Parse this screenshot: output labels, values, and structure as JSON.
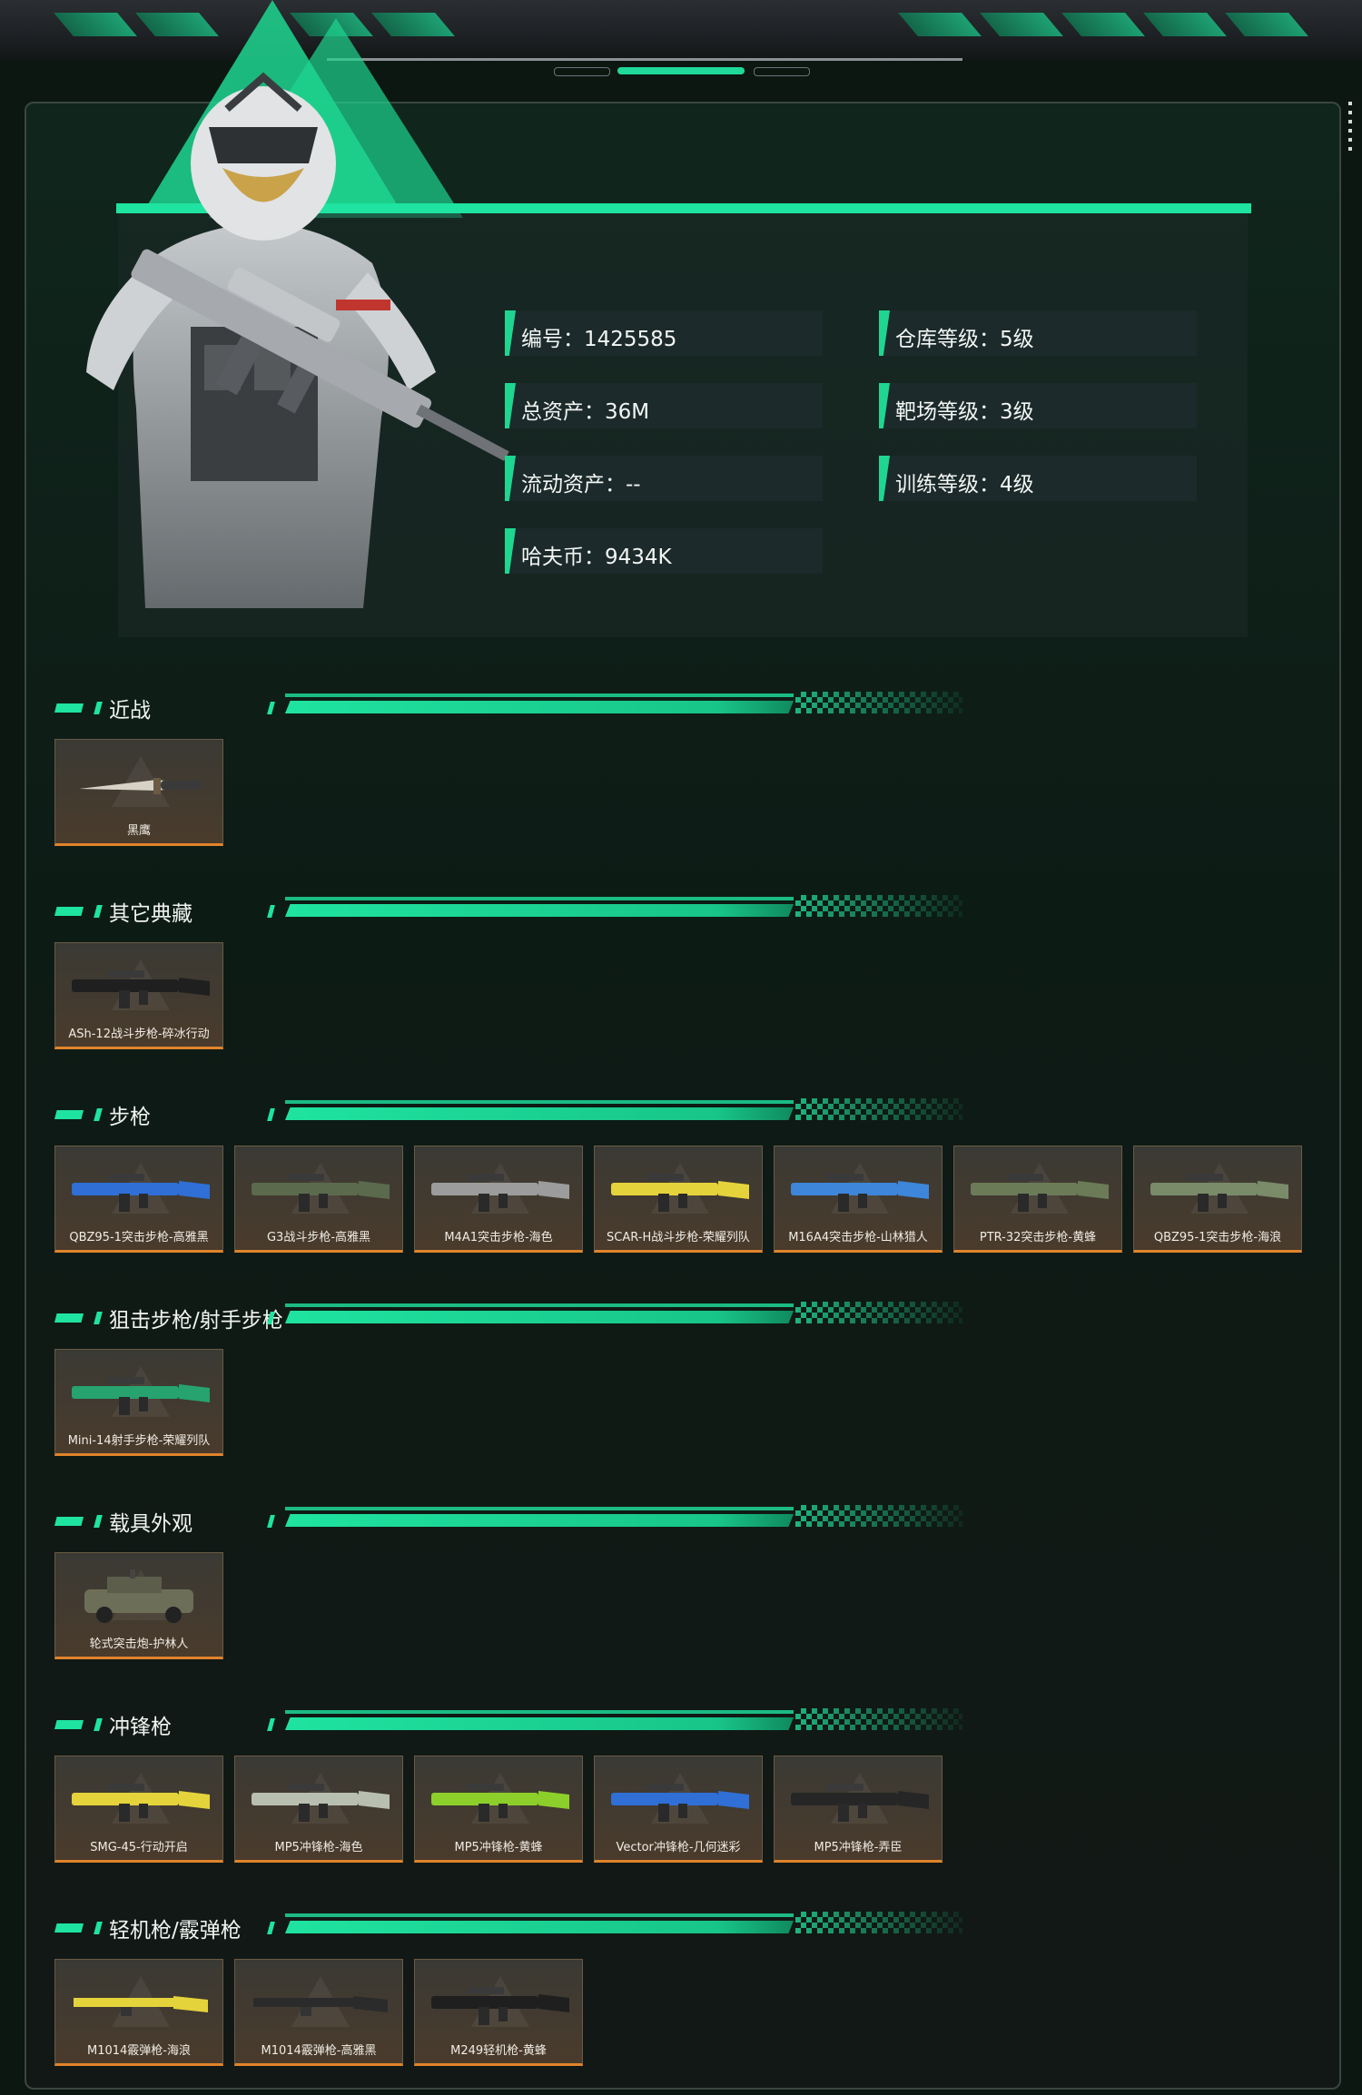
{
  "colors": {
    "accent": "#1fe3a0",
    "card_underline": "#e0842b",
    "background": "#0d1b15"
  },
  "profile": {
    "stats": [
      {
        "label": "编号：1425585"
      },
      {
        "label": "仓库等级：5级"
      },
      {
        "label": "总资产：36M"
      },
      {
        "label": "靶场等级：3级"
      },
      {
        "label": "流动资产：--"
      },
      {
        "label": "训练等级：4级"
      },
      {
        "label": "哈夫币：9434K"
      }
    ]
  },
  "sections": [
    {
      "title": "近战",
      "items": [
        {
          "name": "黑鹰",
          "icon": "knife-icon"
        }
      ]
    },
    {
      "title": "其它典藏",
      "items": [
        {
          "name": "ASh-12战斗步枪-碎冰行动",
          "icon": "rifle-icon"
        }
      ]
    },
    {
      "title": "步枪",
      "items": [
        {
          "name": "QBZ95-1突击步枪-高雅黑",
          "icon": "rifle-icon"
        },
        {
          "name": "G3战斗步枪-高雅黑",
          "icon": "rifle-icon"
        },
        {
          "name": "M4A1突击步枪-海色",
          "icon": "rifle-icon"
        },
        {
          "name": "SCAR-H战斗步枪-荣耀列队",
          "icon": "rifle-icon"
        },
        {
          "name": "M16A4突击步枪-山林猎人",
          "icon": "rifle-icon"
        },
        {
          "name": "PTR-32突击步枪-黄蜂",
          "icon": "rifle-icon"
        },
        {
          "name": "QBZ95-1突击步枪-海浪",
          "icon": "rifle-icon"
        }
      ]
    },
    {
      "title": "狙击步枪/射手步枪",
      "items": [
        {
          "name": "Mini-14射手步枪-荣耀列队",
          "icon": "sniper-icon"
        }
      ]
    },
    {
      "title": "载具外观",
      "items": [
        {
          "name": "轮式突击炮-护林人",
          "icon": "vehicle-icon"
        }
      ]
    },
    {
      "title": "冲锋枪",
      "items": [
        {
          "name": "SMG-45-行动开启",
          "icon": "smg-icon"
        },
        {
          "name": "MP5冲锋枪-海色",
          "icon": "smg-icon"
        },
        {
          "name": "MP5冲锋枪-黄蜂",
          "icon": "smg-icon"
        },
        {
          "name": "Vector冲锋枪-几何迷彩",
          "icon": "smg-icon"
        },
        {
          "name": "MP5冲锋枪-弄臣",
          "icon": "smg-icon"
        }
      ]
    },
    {
      "title": "轻机枪/霰弹枪",
      "items": [
        {
          "name": "M1014霰弹枪-海浪",
          "icon": "shotgun-icon"
        },
        {
          "name": "M1014霰弹枪-高雅黑",
          "icon": "shotgun-icon"
        },
        {
          "name": "M249轻机枪-黄蜂",
          "icon": "lmg-icon"
        }
      ]
    }
  ]
}
